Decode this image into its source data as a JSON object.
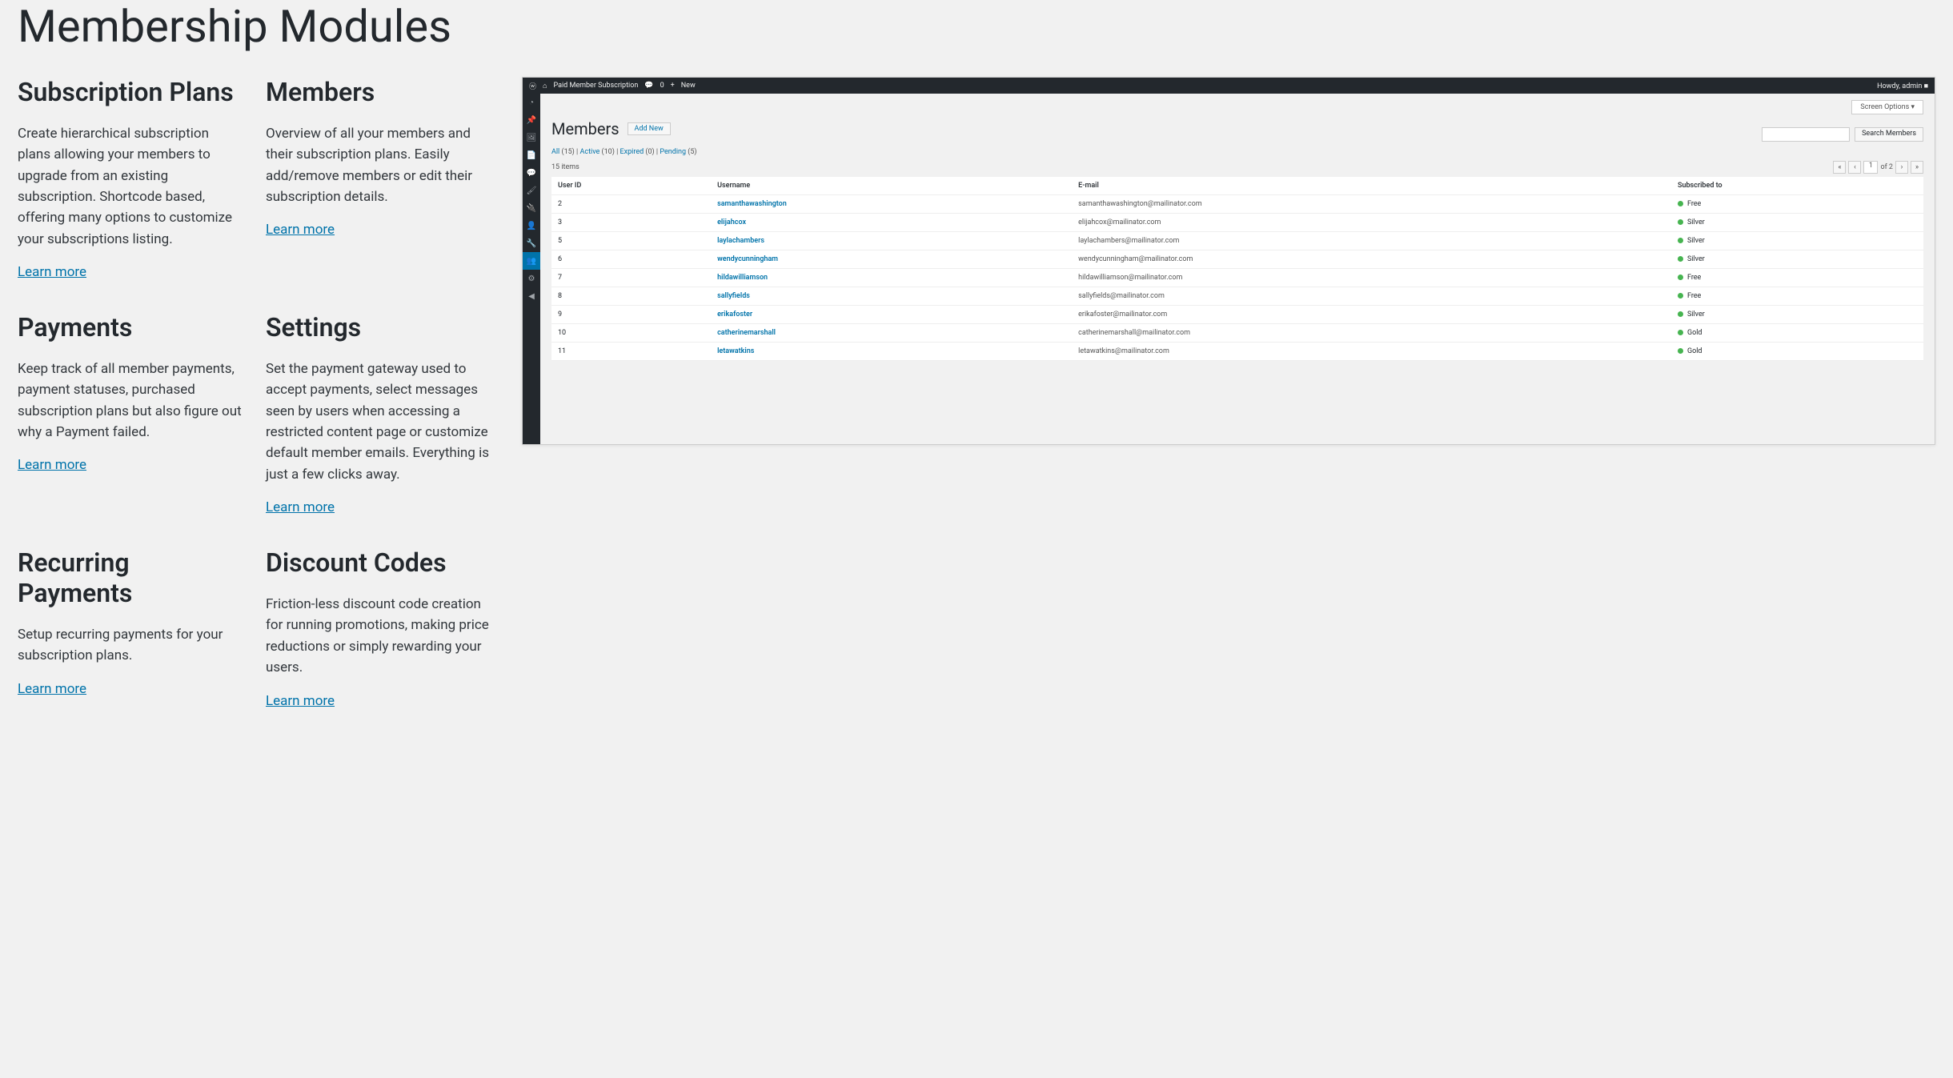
{
  "page": {
    "title": "Membership Modules"
  },
  "modules": [
    {
      "title": "Subscription Plans",
      "desc": "Create hierarchical subscription plans allowing your members to upgrade from an existing subscription. Shortcode based, offering many options to customize your subscriptions listing.",
      "link": "Learn more"
    },
    {
      "title": "Members",
      "desc": "Overview of all your members and their subscription plans. Easily add/remove members or edit their subscription details.",
      "link": "Learn more"
    },
    {
      "title": "Payments",
      "desc": "Keep track of all member payments, payment statuses, purchased subscription plans but also figure out why a Payment failed.",
      "link": "Learn more"
    },
    {
      "title": "Settings",
      "desc": "Set the payment gateway used to accept payments, select messages seen by users when accessing a restricted content page or customize default member emails. Everything is just a few clicks away.",
      "link": "Learn more"
    },
    {
      "title": "Recurring Payments",
      "desc": "Setup recurring payments for your subscription plans.",
      "link": "Learn more"
    },
    {
      "title": "Discount Codes",
      "desc": "Friction-less discount code creation for running promotions, making price reductions or simply rewarding your users.",
      "link": "Learn more"
    }
  ],
  "screenshot": {
    "topbar": {
      "site_title": "Paid Member Subscription",
      "comments_badge": "0",
      "new_label": "New",
      "howdy": "Howdy, admin"
    },
    "screen_options": "Screen Options ▾",
    "page_title": "Members",
    "add_new": "Add New",
    "filters": {
      "all": "All",
      "all_count": "(15)",
      "active": "Active",
      "active_count": "(10)",
      "expired": "Expired",
      "expired_count": "(0)",
      "pending": "Pending",
      "pending_count": "(5)"
    },
    "search_btn": "Search Members",
    "items_count": "15 items",
    "page_input": "1",
    "page_of": "of 2",
    "columns": {
      "id": "User ID",
      "username": "Username",
      "email": "E-mail",
      "sub": "Subscribed to"
    },
    "rows": [
      {
        "id": "2",
        "user": "samanthawashington",
        "mail": "samanthawashington@mailinator.com",
        "sub": "Free"
      },
      {
        "id": "3",
        "user": "elijahcox",
        "mail": "elijahcox@mailinator.com",
        "sub": "Silver"
      },
      {
        "id": "5",
        "user": "laylachambers",
        "mail": "laylachambers@mailinator.com",
        "sub": "Silver"
      },
      {
        "id": "6",
        "user": "wendycunningham",
        "mail": "wendycunningham@mailinator.com",
        "sub": "Silver"
      },
      {
        "id": "7",
        "user": "hildawilliamson",
        "mail": "hildawilliamson@mailinator.com",
        "sub": "Free"
      },
      {
        "id": "8",
        "user": "sallyfields",
        "mail": "sallyfields@mailinator.com",
        "sub": "Free"
      },
      {
        "id": "9",
        "user": "erikafoster",
        "mail": "erikafoster@mailinator.com",
        "sub": "Silver"
      },
      {
        "id": "10",
        "user": "catherinemarshall",
        "mail": "catherinemarshall@mailinator.com",
        "sub": "Gold"
      },
      {
        "id": "11",
        "user": "letawatkins",
        "mail": "letawatkins@mailinator.com",
        "sub": "Gold"
      }
    ],
    "sidebar_icons": [
      "gauge",
      "pin",
      "media",
      "page",
      "comment",
      "brush",
      "plugin",
      "user",
      "tool",
      "gear",
      "circle"
    ]
  }
}
